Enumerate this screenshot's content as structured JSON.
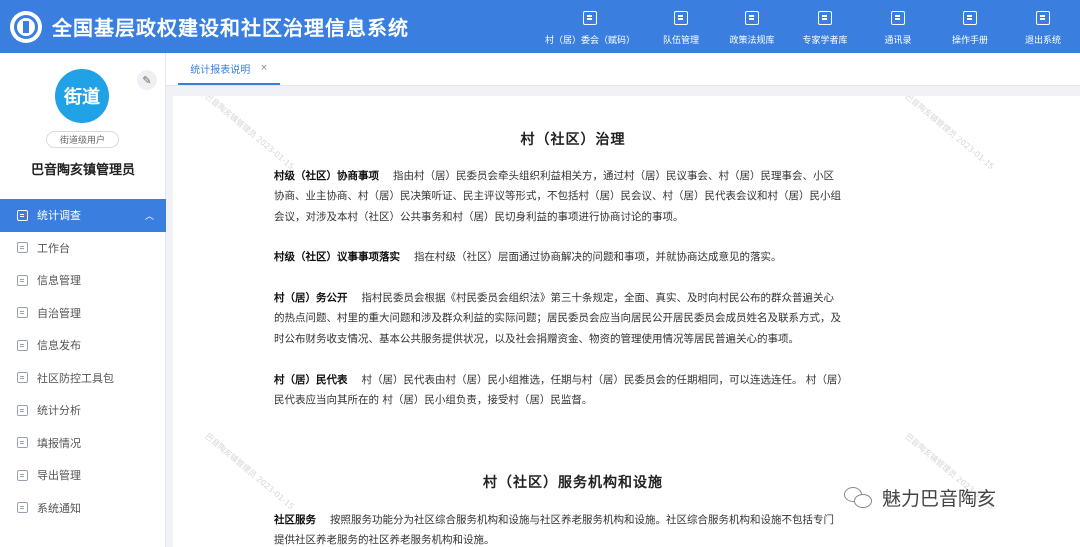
{
  "header": {
    "title": "全国基层政权建设和社区治理信息系统",
    "nav": [
      {
        "label": "村（居）委会（赋码）",
        "icon": "scan-icon"
      },
      {
        "label": "队伍管理",
        "icon": "team-icon"
      },
      {
        "label": "政策法规库",
        "icon": "policy-icon"
      },
      {
        "label": "专家学者库",
        "icon": "book-icon"
      },
      {
        "label": "通讯录",
        "icon": "contacts-icon"
      },
      {
        "label": "操作手册",
        "icon": "manual-icon"
      },
      {
        "label": "退出系统",
        "icon": "logout-icon"
      }
    ]
  },
  "sidebar": {
    "avatar_text": "街道",
    "role": "街道级用户",
    "user": "巴音陶亥镇管理员",
    "menu": [
      {
        "label": "统计调查",
        "active": true
      },
      {
        "label": "工作台"
      },
      {
        "label": "信息管理"
      },
      {
        "label": "自治管理"
      },
      {
        "label": "信息发布"
      },
      {
        "label": "社区防控工具包"
      },
      {
        "label": "统计分析"
      },
      {
        "label": "填报情况"
      },
      {
        "label": "导出管理"
      },
      {
        "label": "系统通知"
      }
    ]
  },
  "tabs": [
    {
      "label": "统计报表说明",
      "close": "×"
    }
  ],
  "watermark_text": "巴音陶亥镇管理员 2023-01-15",
  "content": {
    "section1_title": "村（社区）治理",
    "p1_term": "村级（社区）协商事项",
    "p1_text": "指由村（居）民委员会牵头组织利益相关方，通过村（居）民议事会、村（居）民理事会、小区协商、业主协商、村（居）民决策听证、民主评议等形式，不包括村（居）民会议、村（居）民代表会议和村（居）民小组会议，对涉及本村（社区）公共事务和村（居）民切身利益的事项进行协商讨论的事项。",
    "p2_term": "村级（社区）议事事项落实",
    "p2_text": "指在村级（社区）层面通过协商解决的问题和事项，并就协商达成意见的落实。",
    "p3_term": "村（居）务公开",
    "p3_text": "指村民委员会根据《村民委员会组织法》第三十条规定，全面、真实、及时向村民公布的群众普遍关心的热点问题、村里的重大问题和涉及群众利益的实际问题；居民委员会应当向居民公开居民委员会成员姓名及联系方式，及时公布财务收支情况、基本公共服务提供状况，以及社会捐赠资金、物资的管理使用情况等居民普遍关心的事项。",
    "p4_term": "村（居）民代表",
    "p4_text": "村（居）民代表由村（居）民小组推选，任期与村（居）民委员会的任期相同，可以连选连任。 村（居）民代表应当向其所在的 村（居）民小组负责，接受村（居）民监督。",
    "section2_title": "村（社区）服务机构和设施",
    "p5_term": "社区服务",
    "p5_text": "按照服务功能分为社区综合服务机构和设施与社区养老服务机构和设施。社区综合服务机构和设施不包括专门提供社区养老服务的社区养老服务机构和设施。"
  },
  "wechat_label": "魅力巴音陶亥"
}
